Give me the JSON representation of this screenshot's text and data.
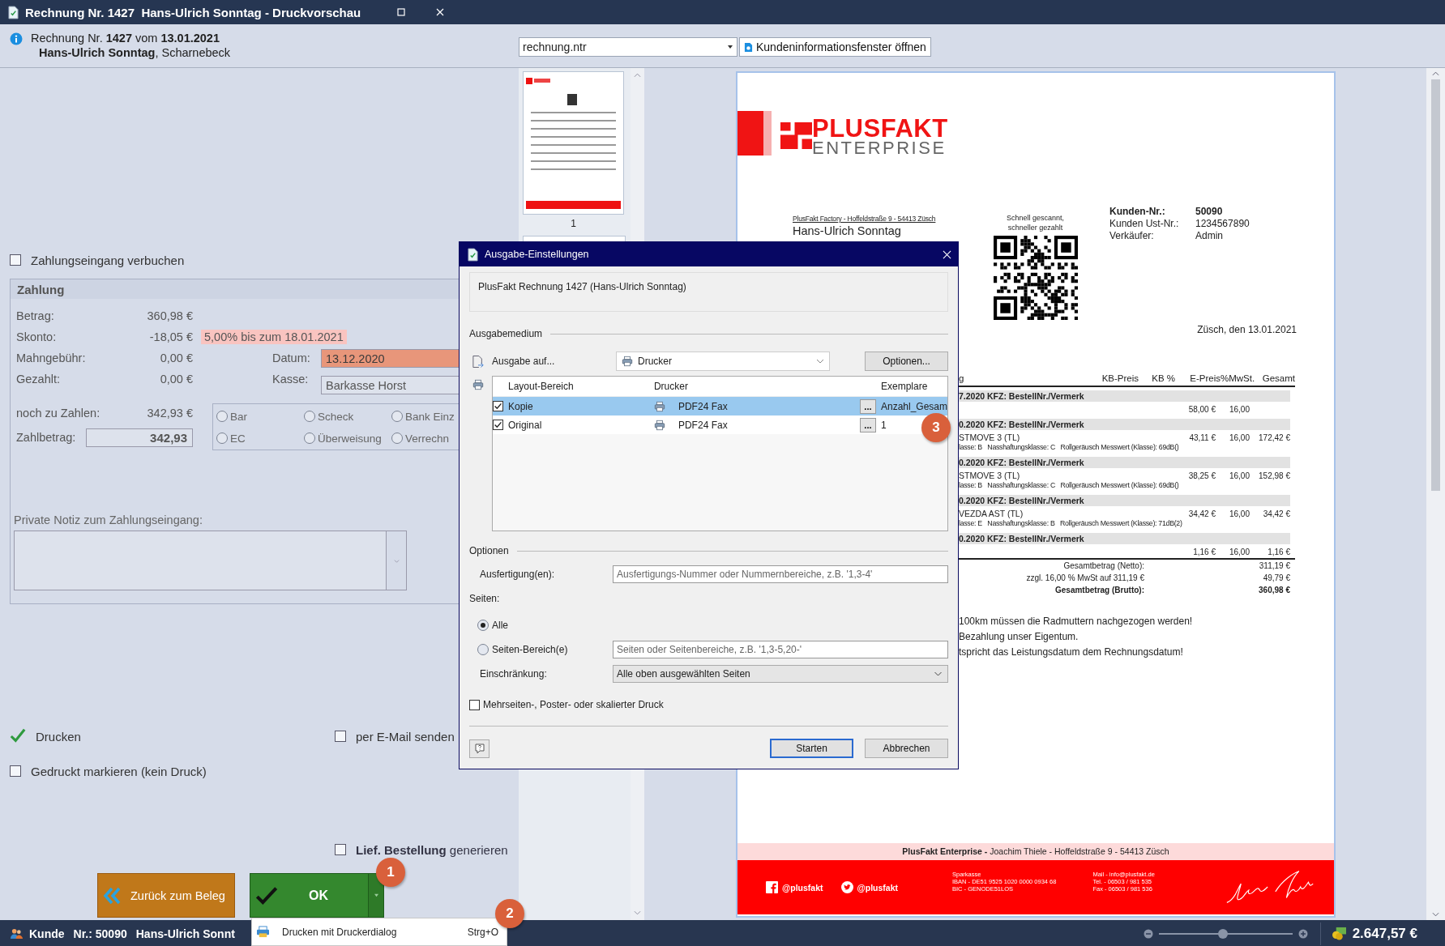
{
  "window": {
    "title": "Rechnung Nr. 1427  Hans-Ulrich Sonntag - Druckvorschau"
  },
  "header": {
    "line1": "Rechnung Nr. **1427** vom **13.01.2021**",
    "line2": "**Hans-Ulrich Sonntag**, Scharnebeck",
    "template": "rechnung.ntr",
    "info_button": "Kundeninformationsfenster öffnen"
  },
  "payment": {
    "book_checkbox": {
      "label": "Zahlungseingang verbuchen",
      "checked": false
    },
    "title": "Zahlung",
    "rows": [
      {
        "label": "Betrag:",
        "value": "360,98 €"
      },
      {
        "label": "Skonto:",
        "value": "-18,05 €",
        "note": "5,00% bis zum 18.01.2021"
      },
      {
        "label": "Mahngebühr:",
        "value": "0,00 €"
      },
      {
        "label": "Gezahlt:",
        "value": "0,00 €"
      }
    ],
    "date": {
      "label": "Datum:",
      "value": "13.12.2020"
    },
    "cash": {
      "label": "Kasse:",
      "value": "Barkasse Horst"
    },
    "remaining": {
      "label": "noch zu Zahlen:",
      "value": "342,93 €"
    },
    "amount": {
      "label": "Zahlbetrag:",
      "value": "342,93"
    },
    "methods": [
      {
        "label": "Bar",
        "selected": false
      },
      {
        "label": "Scheck",
        "selected": false
      },
      {
        "label": "Bank Einz",
        "selected": false
      },
      {
        "label": "EC",
        "selected": false
      },
      {
        "label": "Überweisung",
        "selected": false
      },
      {
        "label": "Verrechn",
        "selected": false
      }
    ],
    "note_label": "Private Notiz zum Zahlungseingang:"
  },
  "options": [
    {
      "label": "Drucken",
      "checked": true
    },
    {
      "label": "per E-Mail senden",
      "checked": false
    },
    {
      "label": "Gedruckt markieren (kein Druck)",
      "checked": false
    },
    {
      "label": "**Lief. Bestellung** generieren",
      "checked": false
    }
  ],
  "buttons": {
    "back": "Zurück zum Beleg",
    "ok": "OK"
  },
  "ok_menu": {
    "label": "Drucken mit Druckerdialog",
    "shortcut": "Strg+O"
  },
  "thumbnails": [
    {
      "label": "1"
    }
  ],
  "invoice": {
    "logo": {
      "name": "PLUSFAKT",
      "tagline": "ENTERPRISE"
    },
    "sender_line": "PlusFakt Factory - Hoffeldstraße 9 - 54413 Züsch",
    "recipient": "Hans-Ulrich Sonntag",
    "qr_caption": [
      "Schnell gescannt,",
      "schneller gezahlt"
    ],
    "customer_info": [
      {
        "label": "Kunden-Nr.:",
        "value": "50090"
      },
      {
        "label": "Kunden Ust-Nr.:",
        "value": "1234567890"
      },
      {
        "label": "Verkäufer:",
        "value": "Admin"
      }
    ],
    "date_line": "Züsch, den 13.01.2021",
    "columns": [
      "g",
      "KB-Preis",
      "KB %",
      "E-Preis",
      "%MwSt.",
      "Gesamt"
    ],
    "rows": [
      {
        "kind": "group",
        "text": "7.2020 KFZ: BestellNr./Vermerk"
      },
      {
        "kind": "item",
        "e_price": "58,00 €",
        "vat": "16,00"
      },
      {
        "kind": "group",
        "text": "0.2020 KFZ: BestellNr./Vermerk"
      },
      {
        "kind": "item",
        "name": "STMOVE 3 (TL)",
        "detail": "lasse: B   Nasshaftungsklasse: C   Rollgeräusch Messwert (Klasse): 69dB()",
        "e_price": "43,11 €",
        "vat": "16,00",
        "total": "172,42 €"
      },
      {
        "kind": "group",
        "text": "0.2020 KFZ: BestellNr./Vermerk"
      },
      {
        "kind": "item",
        "name": "STMOVE 3 (TL)",
        "detail": "lasse: B   Nasshaftungsklasse: C   Rollgeräusch Messwert (Klasse): 69dB()",
        "e_price": "38,25 €",
        "vat": "16,00",
        "total": "152,98 €"
      },
      {
        "kind": "group",
        "text": "0.2020 KFZ: BestellNr./Vermerk"
      },
      {
        "kind": "item",
        "name": "VEZDA AST (TL)",
        "detail": "lasse: E   Nasshaftungsklasse: B   Rollgeräusch Messwert (Klasse): 71dB(2)",
        "e_price": "34,42 €",
        "vat": "16,00",
        "total": "34,42 €"
      },
      {
        "kind": "group",
        "text": "0.2020 KFZ: BestellNr./Vermerk"
      },
      {
        "kind": "item",
        "e_price": "1,16 €",
        "vat": "16,00",
        "total": "1,16 €"
      }
    ],
    "totals": [
      {
        "label": "Gesamtbetrag (Netto):",
        "value": "311,19 €"
      },
      {
        "label": "zzgl. 16,00 % MwSt auf 311,19 €",
        "value": "49,79 €"
      },
      {
        "label": "Gesamtbetrag (Brutto):",
        "value": "360,98 €"
      }
    ],
    "notes": [
      "100km müssen die Radmuttern nachgezogen werden!",
      "Bezahlung unser Eigentum.",
      "tspricht das Leistungsdatum dem Rechnungsdatum!"
    ],
    "footer_address": "**PlusFakt Enterprise -** Joachim Thiele - Hoffeldstraße 9 - 54413 Züsch",
    "social": [
      {
        "kind": "facebook",
        "handle": "@plusfakt"
      },
      {
        "kind": "twitter",
        "handle": "@plusfakt"
      }
    ],
    "bank": [
      "Sparkasse",
      "IBAN - DE51 9525 1020 0000 0934 68",
      "BIC - GENODE51LOS"
    ],
    "contact": [
      "Mail - info@plusfakt.de",
      "Tel. - 06503 / 981 535",
      "Fax - 06503 / 981 536"
    ]
  },
  "dialog": {
    "title": "Ausgabe-Einstellungen",
    "description": "PlusFakt Rechnung 1427 (Hans-Ulrich Sonntag)",
    "medium_section": "Ausgabemedium",
    "output_label": "Ausgabe auf...",
    "output_value": "Drucker",
    "options_button": "Optionen...",
    "columns": [
      "Layout-Bereich",
      "Drucker",
      "Exemplare"
    ],
    "rows": [
      {
        "checked": true,
        "selected": true,
        "layout": "Kopie",
        "printer": "PDF24 Fax",
        "more": "...",
        "copies": "Anzahl_Gesam"
      },
      {
        "checked": true,
        "selected": false,
        "layout": "Original",
        "printer": "PDF24 Fax",
        "more": "...",
        "copies": "1"
      }
    ],
    "options_section": "Optionen",
    "copies_label": "Ausfertigung(en):",
    "copies_placeholder": "Ausfertigungs-Nummer oder Nummernbereiche, z.B. '1,3-4'",
    "pages_label": "Seiten:",
    "page_modes": [
      {
        "label": "Alle",
        "selected": true
      },
      {
        "label": "Seiten-Bereich(e)",
        "selected": false,
        "placeholder": "Seiten oder Seitenbereiche, z.B. '1,3-5,20-'"
      }
    ],
    "restriction_label": "Einschränkung:",
    "restriction_value": "Alle oben ausgewählten Seiten",
    "multipage": {
      "label": "Mehrseiten-, Poster- oder skalierter Druck",
      "checked": false
    },
    "start": "Starten",
    "cancel": "Abbrechen"
  },
  "status_bar": {
    "customer": [
      "Kunde",
      "Nr.: 50090",
      "Hans-Ulrich Sonnt"
    ],
    "zoom": {
      "level": 0.48
    },
    "total": "2.647,57 €"
  },
  "callouts": [
    "1",
    "2",
    "3"
  ]
}
